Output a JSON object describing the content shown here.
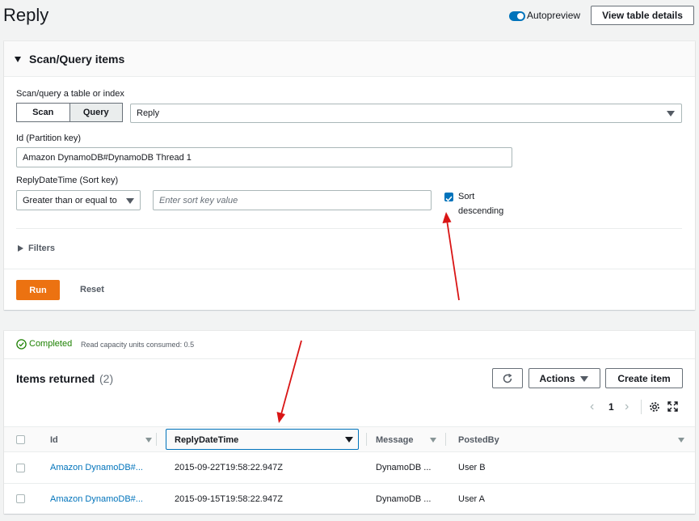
{
  "header": {
    "title": "Reply",
    "autopreview_label": "Autopreview",
    "view_details_label": "View table details"
  },
  "scan_query": {
    "section_title": "Scan/Query items",
    "target_label": "Scan/query a table or index",
    "scan_label": "Scan",
    "query_label": "Query",
    "table_select_value": "Reply",
    "partition_key_label": "Id (Partition key)",
    "partition_key_value": "Amazon DynamoDB#DynamoDB Thread 1",
    "sort_key_label": "ReplyDateTime (Sort key)",
    "sort_operator_value": "Greater than or equal to",
    "sort_key_placeholder": "Enter sort key value",
    "sort_descending_label_1": "Sort",
    "sort_descending_label_2": "descending",
    "sort_descending_checked": true,
    "filters_label": "Filters",
    "run_label": "Run",
    "reset_label": "Reset"
  },
  "results": {
    "status_label": "Completed",
    "capacity_text": "Read capacity units consumed: 0.5",
    "items_title": "Items returned",
    "items_count": "(2)",
    "actions_label": "Actions",
    "create_item_label": "Create item",
    "page_number": "1",
    "columns": [
      "Id",
      "ReplyDateTime",
      "Message",
      "PostedBy"
    ],
    "rows": [
      {
        "id": "Amazon DynamoDB#...",
        "reply_date_time": "2015-09-22T19:58:22.947Z",
        "message": "DynamoDB ...",
        "posted_by": "User B"
      },
      {
        "id": "Amazon DynamoDB#...",
        "reply_date_time": "2015-09-15T19:58:22.947Z",
        "message": "DynamoDB ...",
        "posted_by": "User A"
      }
    ]
  },
  "colors": {
    "accent": "#0073bb",
    "run_button": "#ec7211",
    "success": "#1d8102",
    "annotation_arrow": "#d91515"
  }
}
